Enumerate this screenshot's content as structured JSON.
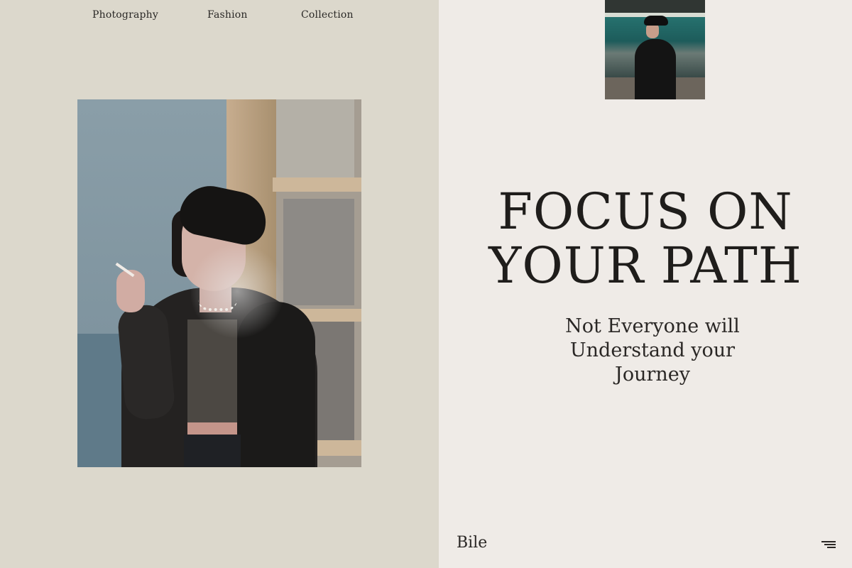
{
  "nav": {
    "items": [
      {
        "label": "Photography"
      },
      {
        "label": "Fashion"
      },
      {
        "label": "Collection"
      }
    ]
  },
  "hero": {
    "headline_lines": [
      "FOCUS ON",
      "YOUR PATH"
    ],
    "subline_lines": [
      "Not Everyone will",
      "Understand your",
      "Journey"
    ]
  },
  "footer": {
    "brand": "Bile",
    "menu_icon": "hamburger-menu-icon"
  },
  "colors": {
    "left_panel_bg": "#dcd8cc",
    "right_panel_bg": "#efebe7",
    "text": "#1f1d1b"
  }
}
